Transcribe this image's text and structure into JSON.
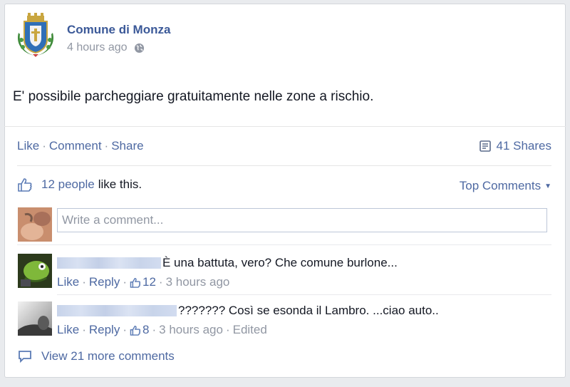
{
  "post": {
    "author": "Comune di Monza",
    "time": "4 hours ago",
    "privacy_icon": "globe-icon",
    "text": "E' possibile parcheggiare gratuitamente nelle zone a rischio."
  },
  "actions": {
    "like": "Like",
    "comment": "Comment",
    "share": "Share",
    "shares_count": "41 Shares"
  },
  "likes": {
    "people": "12 people",
    "rest": "like this.",
    "sort": "Top Comments"
  },
  "composer": {
    "placeholder": "Write a comment..."
  },
  "comments": [
    {
      "text": "È una battuta, vero? Che comune burlone...",
      "like": "Like",
      "reply": "Reply",
      "like_count": "12",
      "time": "3 hours ago",
      "edited": ""
    },
    {
      "text": "??????? Così se esonda il Lambro. ...ciao auto..",
      "like": "Like",
      "reply": "Reply",
      "like_count": "8",
      "time": "3 hours ago",
      "edited": "Edited"
    }
  ],
  "view_more": "View 21 more comments",
  "colors": {
    "link": "#4e69a2",
    "author": "#3b5998",
    "muted": "#9197a3"
  }
}
